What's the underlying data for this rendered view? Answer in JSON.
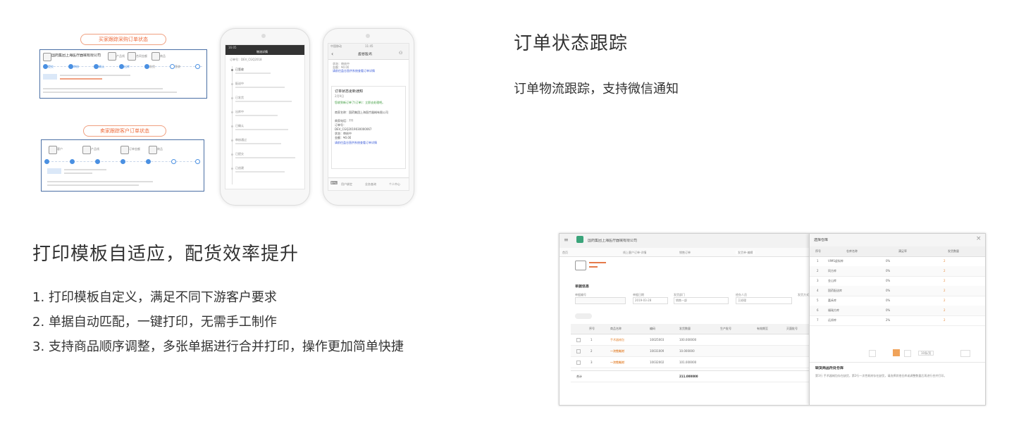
{
  "section_tracking": {
    "title": "订单状态跟踪",
    "subtitle": "订单物流跟踪，支持微信通知"
  },
  "section_print": {
    "title": "打印模板自适应，配货效率提升",
    "items": [
      "1. 打印模板自定义，满足不同下游客户要求",
      "2. 单据自动匹配，一键打印，无需手工制作",
      "3. 支持商品顺序调整，多张单据进行合并打印，操作更加简单快捷"
    ]
  },
  "illus_tracking": {
    "buyer_pill": "买家跟踪采购订单状态",
    "seller_pill": "卖家跟踪客户订单状态",
    "buyer_company": "国药集团上海医疗器械有限公司",
    "buyer_labels": [
      "采购商",
      "产品线",
      "合同金额",
      "商品"
    ],
    "seller_labels": [
      "客户",
      "产品线",
      "订单金额",
      "商品"
    ],
    "steps": [
      "提交",
      "审核",
      "确认",
      "出库",
      "发货",
      "签收",
      "完成"
    ],
    "phone_left": {
      "header": "物流详情",
      "time": "16:05",
      "order_line": "订单号：DEV_CGQ2018",
      "events": [
        "已签收",
        "配送中",
        "已发货",
        "出库中",
        "已确认",
        "审核通过",
        "已提交",
        "已创建"
      ]
    },
    "phone_right": {
      "carrier": "中国移动",
      "time": "11:45",
      "header": "盈谷医讯",
      "top_lines": [
        "状态：审核中",
        "金额：¥0.00"
      ],
      "top_link": "请前往盈谷直供系统查看订单详情",
      "card_title": "订单状态更新通知",
      "card_date": "2月9日",
      "card_green": "您收到新订单了(订单)：立即去处理吧。",
      "card_lines": [
        "商家名称：国药集团上海医疗器械有限公司",
        "商家电话：???",
        "订单号：",
        "DEV_CGQ2019030000067",
        "状态：审核中",
        "金额：¥0.00"
      ],
      "card_link": "请前往盈谷直供系统查看订单详情",
      "tabs": [
        "用户绑定",
        "业务查询",
        "个人中心"
      ]
    }
  },
  "illus_print": {
    "company": "国药集团上海医疗器械有限公司",
    "nav_home": "首页",
    "tabs": [
      "线上客户订单-详情",
      "销售订单",
      "发货单-编辑"
    ],
    "form_title": "单据信息",
    "form_labels": [
      "单据编号",
      "单据日期",
      "发货部门",
      "经办人员",
      "发货方式"
    ],
    "form_values": [
      "",
      "2019-03-28",
      "销售一部",
      "王经理",
      ""
    ],
    "table_headers": [
      "序号",
      "商品名称",
      "编码",
      "发货数量",
      "生产批号",
      "有效期至",
      "灭菌批号"
    ],
    "table_rows": [
      [
        "1",
        "手术器械包",
        "10025003",
        "100.000000"
      ],
      [
        "2",
        "一次性耗材",
        "10031009",
        "10.000000"
      ],
      [
        "3",
        "一次性耗材",
        "10032002",
        "101.000000"
      ]
    ],
    "total_label": "合计",
    "total_value": "211.000000",
    "dialog": {
      "title": "选择仓库",
      "headers": [
        "序号",
        "仓库名称",
        "满足率",
        "发货数量"
      ],
      "rows": [
        [
          "1",
          "VIMS虚拟库",
          "0%",
          "2"
        ],
        [
          "2",
          "同方库",
          "0%",
          "2"
        ],
        [
          "3",
          "金山库",
          "0%",
          "2"
        ],
        [
          "4",
          "国药配送库",
          "0%",
          "2"
        ],
        [
          "5",
          "嘉禾库",
          "0%",
          "2"
        ],
        [
          "6",
          "福瑞方库",
          "0%",
          "2"
        ],
        [
          "7",
          "远邦库",
          "2%",
          "2"
        ]
      ],
      "pager": "10条/页",
      "note_title": "缺货商品所处仓库",
      "note_text": "第1行 手术器械包存在缺货，第2行一次性耗材存在缺货，请选择其他仓库或调整数量后再进行合并打印。"
    }
  },
  "colors": {
    "pill_orange": "#ee6a3a",
    "panel_blue": "#4a6fa5",
    "step_blue": "#4a90e2",
    "link_orange": "#e5893a",
    "wx_green": "#3a9a3a"
  }
}
